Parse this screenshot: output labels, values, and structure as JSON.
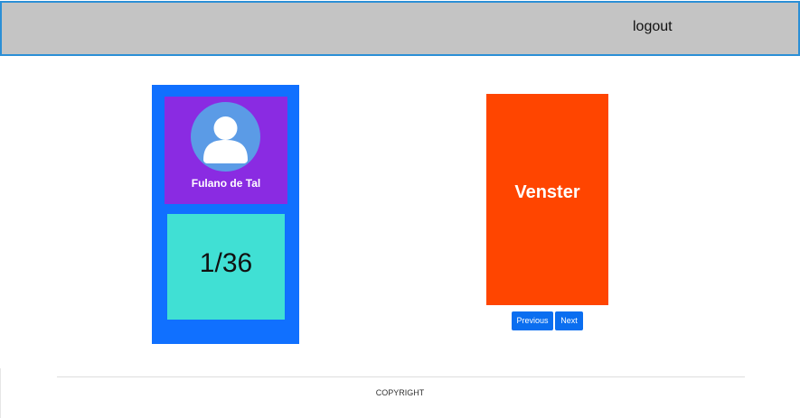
{
  "header": {
    "logout_label": "logout"
  },
  "profile": {
    "name": "Fulano de Tal",
    "avatar_icon": "user-avatar-icon"
  },
  "counter": {
    "text": "1/36"
  },
  "card": {
    "title": "Venster"
  },
  "pagination": {
    "previous_label": "Previous",
    "next_label": "Next"
  },
  "footer": {
    "copyright": "COPYRIGHT"
  },
  "colors": {
    "header_bg": "#c4c4c4",
    "header_border": "#2b8fd6",
    "left_panel": "#1070ff",
    "profile_box": "#8a2be2",
    "counter_box": "#40e0d4",
    "card": "#ff4500",
    "button": "#0a6ef0"
  }
}
